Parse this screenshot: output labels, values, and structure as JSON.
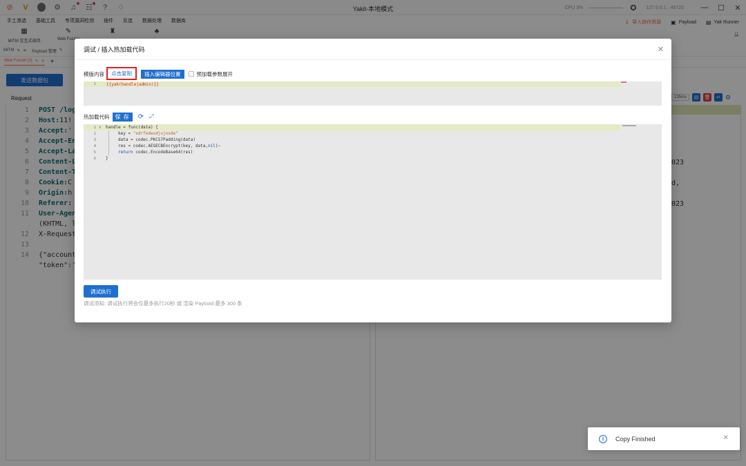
{
  "titlebar": {
    "app_title": "Yakit-本地模式",
    "cpu_label": "CPU 3%",
    "port_text": "127.0.0.1 : 48720",
    "icons": [
      "yak-icon",
      "brand-icon",
      "avatar",
      "settings-icon",
      "bell-icon",
      "notification-icon",
      "help-icon",
      "bell-outline-icon"
    ]
  },
  "menubar": {
    "items": [
      "手工渗透",
      "基础工具",
      "专项漏洞检测",
      "插件",
      "反连",
      "数据处理",
      "数据库"
    ],
    "right": [
      {
        "label": "导入协作资源",
        "icon": "import-icon"
      },
      {
        "label": "Payload",
        "icon": "payload-icon"
      },
      {
        "label": "Yak Runner",
        "icon": "terminal-icon"
      }
    ]
  },
  "toolrow": {
    "tools": [
      {
        "label": "MITM 交互式劫持",
        "icon": "mitm-icon"
      },
      {
        "label": "Web Fuzzer",
        "icon": "fuzzer-icon"
      },
      {
        "label": "",
        "icon": "brute-icon"
      },
      {
        "label": "",
        "icon": "plugin-icon"
      }
    ]
  },
  "tabs": {
    "row1": [
      "MITM",
      "Payload 管理"
    ],
    "row2_active": "Web Fuzzer [1]"
  },
  "background": {
    "send_label": "发送数据包",
    "request_label": "Request",
    "ms_badge": "135ms",
    "code_lines": [
      {
        "n": "1",
        "key": "POST /log",
        "val": ""
      },
      {
        "n": "2",
        "key": "Host:",
        "val": " 11!"
      },
      {
        "n": "3",
        "key": "Accept:",
        "val": " '"
      },
      {
        "n": "4",
        "key": "Accept-En",
        "val": ""
      },
      {
        "n": "5",
        "key": "Accept-La",
        "val": ""
      },
      {
        "n": "6",
        "key": "Content-L",
        "val": ""
      },
      {
        "n": "7",
        "key": "Content-T",
        "val": ""
      },
      {
        "n": "8",
        "key": "Cookie:",
        "val": " C"
      },
      {
        "n": "9",
        "key": "Origin:",
        "val": " h"
      },
      {
        "n": "10",
        "key": "Referer:",
        "val": ""
      },
      {
        "n": "11",
        "key": "User-Agen",
        "val": ""
      },
      {
        "n": "",
        "key": "",
        "val": "(KHTML, l"
      },
      {
        "n": "12",
        "key": "",
        "val": "X-Request"
      },
      {
        "n": "13",
        "key": "",
        "val": ""
      },
      {
        "n": "14",
        "key": "",
        "val": "{\"account"
      },
      {
        "n": "",
        "key": "",
        "val": "\"token\":'"
      }
    ],
    "response_frags": [
      {
        "text": "023"
      },
      {
        "text": "d,"
      },
      {
        "text": "023"
      }
    ]
  },
  "modal": {
    "title": "调试 / 插入热加载代码",
    "template_label": "模版内容",
    "copy_label": "点击复制",
    "insert_label": "插入编辑器位置",
    "preload_label": "预加载参数展开",
    "template_line_no": "1",
    "template_code": "{{yak(handle|admin)}}",
    "hot_label": "热加载代码",
    "save_label": "保 存",
    "code": [
      {
        "n": "1",
        "fold": "∨",
        "indent": 0,
        "parts": [
          {
            "t": "handle = func(data) {",
            "c": "plain"
          }
        ]
      },
      {
        "n": "2",
        "fold": "",
        "indent": 1,
        "parts": [
          {
            "t": "key = ",
            "c": "plain"
          },
          {
            "t": "\"sdrfedwsdjujnsde\"",
            "c": "str"
          }
        ]
      },
      {
        "n": "3",
        "fold": "",
        "indent": 1,
        "parts": [
          {
            "t": "data = codec.PKCS7Padding(data)",
            "c": "plain"
          }
        ]
      },
      {
        "n": "4",
        "fold": "",
        "indent": 1,
        "parts": [
          {
            "t": "res = codec.AESECBEncrypt(key, data,",
            "c": "plain"
          },
          {
            "t": "nil",
            "c": "kw"
          },
          {
            "t": ")~",
            "c": "plain"
          }
        ]
      },
      {
        "n": "5",
        "fold": "",
        "indent": 1,
        "parts": [
          {
            "t": "return",
            "c": "kw"
          },
          {
            "t": " codec.EncodeBase64(res)",
            "c": "plain"
          }
        ]
      },
      {
        "n": "6",
        "fold": "",
        "indent": 0,
        "parts": [
          {
            "t": "}",
            "c": "plain"
          }
        ]
      }
    ],
    "debug_label": "调试执行",
    "hint": "调试须知: 调试执行将会仅最多执行20秒 或 渲染 Payload 最多 300 条"
  },
  "toast": {
    "text": "Copy Finished"
  },
  "colors": {
    "primary": "#1f6fd0",
    "accent_orange": "#f0643c",
    "highlight_line": "#e5e9c6",
    "copy_border": "#e02020"
  }
}
